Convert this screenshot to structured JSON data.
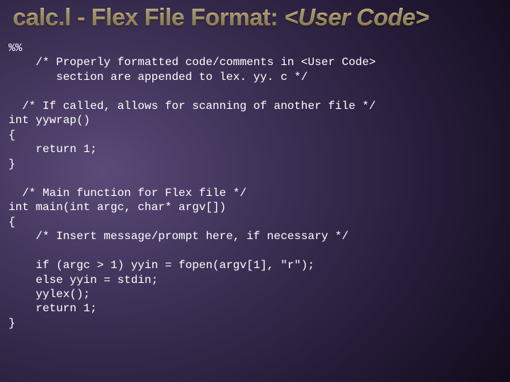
{
  "slide": {
    "title_plain": "calc.l - Flex File Format: <User Code>",
    "title_prefix": "calc.l - Flex File Format: ",
    "title_emph": "<User Code>"
  },
  "code": {
    "lines": [
      "%%",
      "    /* Properly formatted code/comments in <User Code>",
      "       section are appended to lex. yy. c */",
      "",
      "  /* If called, allows for scanning of another file */",
      "int yywrap()",
      "{",
      "    return 1;",
      "}",
      "",
      "  /* Main function for Flex file */",
      "int main(int argc, char* argv[])",
      "{",
      "    /* Insert message/prompt here, if necessary */",
      "",
      "    if (argc > 1) yyin = fopen(argv[1], \"r\");",
      "    else yyin = stdin;",
      "    yylex();",
      "    return 1;",
      "}"
    ]
  }
}
